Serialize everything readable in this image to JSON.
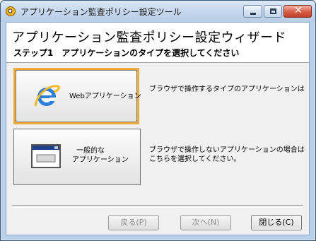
{
  "window": {
    "title": "アプリケーション監査ポリシー設定ツール"
  },
  "header": {
    "title": "アプリケーション監査ポリシー設定ウィザード",
    "subtitle": "ステップ1　アプリケーションのタイプを選択してください"
  },
  "options": [
    {
      "label": "Webアプリケーション",
      "icon": "ie-icon",
      "description": [
        "ブラウザで操作するタイプのアプリケーションは"
      ],
      "selected": true
    },
    {
      "label": "一般的な アプリケーション",
      "label_lines": [
        "一般的な",
        "アプリケーション"
      ],
      "icon": "window-icon",
      "description": [
        "ブラウザで操作しないアプリケーションの場合は",
        "こちらを選択してください。"
      ],
      "selected": false
    }
  ],
  "buttons": {
    "back": "戻る(P)",
    "next": "次へ(N)",
    "close": "閉じる(C)"
  },
  "colors": {
    "selection_border": "#f0a93a",
    "titlebar": "#c3d6ec",
    "close_button": "#d9624a"
  }
}
